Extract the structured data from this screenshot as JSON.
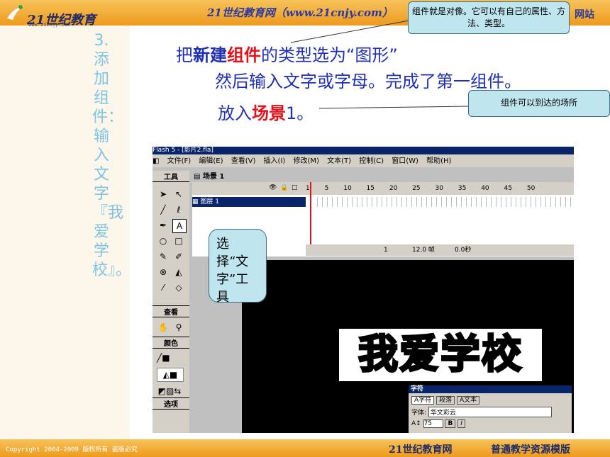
{
  "header": {
    "logo_text": "21世纪教育",
    "logo_sub": "www.21cnjy.com",
    "site_title": "21世纪教育网（www.21cnjy.com）",
    "right_text": "网站"
  },
  "vertical_title": "3. 添加组件：输入文字『我爱学校』。",
  "lines": {
    "l1_a": "把",
    "l1_b": "新建",
    "l1_c": "组件",
    "l1_d": "的类型选为“图形”",
    "l2": "然后输入文字或字母。完成了第一组件。",
    "l3_a": "放入",
    "l3_b": "场景",
    "l3_c": "1。"
  },
  "callouts": {
    "c1": "组件就是对像。它可以有自己的属性、方法、类型。",
    "c2": "组件可以到达的场所",
    "c3": "选择“文字”工具"
  },
  "flash": {
    "title": "Flash 5 - [影片2.fla]",
    "menu": [
      "文件(F)",
      "编辑(E)",
      "查看(V)",
      "插入(I)",
      "修改(M)",
      "文本(T)",
      "控制(C)",
      "窗口(W)",
      "帮助(H)"
    ],
    "scene": "场景 1",
    "toolbox_heads": [
      "工具",
      "查看",
      "颜色",
      "选项"
    ],
    "layer": "图层 1",
    "ruler": [
      "1",
      "5",
      "10",
      "15",
      "20",
      "25",
      "30",
      "35",
      "40",
      "45",
      "50"
    ],
    "frame": "1",
    "fps": "12.0 帧",
    "time": "0.0秒",
    "stage_text": "我爱学校",
    "char_panel_title": "字符",
    "char_tabs": [
      "A字符",
      "段落",
      "A文本"
    ],
    "font_label": "字体:",
    "font_value": "华文彩云",
    "size_value": "75"
  },
  "footer": {
    "copyright": "Copyright 2004-2009 版权所有 盗版必究",
    "site": "21世纪教育网",
    "tagline": "普通教学资源模版"
  },
  "colors": {
    "header": "#f0a22a",
    "footer": "#f0a22a",
    "text": "#1f2fb8",
    "highlight": "#e8101a"
  }
}
